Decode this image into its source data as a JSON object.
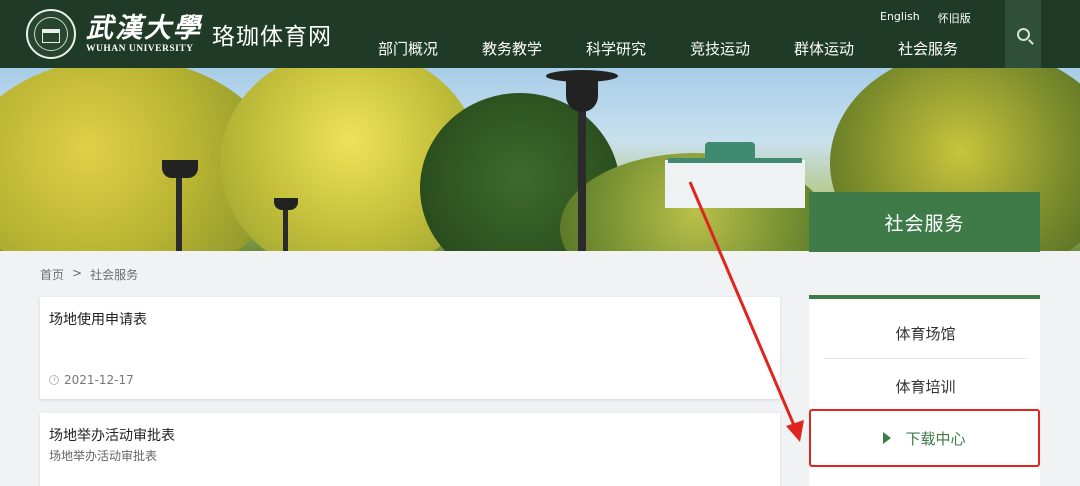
{
  "header": {
    "university_cn": "武漢大學",
    "university_en": "WUHAN UNIVERSITY",
    "site_name": "珞珈体育网",
    "top_links": [
      "English",
      "怀旧版"
    ],
    "nav": [
      "部门概况",
      "教务教学",
      "科学研究",
      "竞技运动",
      "群体运动",
      "社会服务"
    ],
    "search_icon": "search-icon"
  },
  "banner": {
    "section_title": "社会服务"
  },
  "breadcrumb": {
    "home": "首页",
    "separator": ">",
    "current": "社会服务"
  },
  "list": [
    {
      "title": "场地使用申请表",
      "date": "2021-12-17"
    },
    {
      "title": "场地举办活动审批表",
      "desc": "场地举办活动审批表"
    }
  ],
  "sidebar": {
    "items": [
      "体育场馆",
      "体育培训",
      "下载中心"
    ],
    "active_index": 2
  },
  "colors": {
    "header_bg": "#1f3a27",
    "accent_green": "#3e7b49",
    "highlight_red": "#e0241f"
  }
}
